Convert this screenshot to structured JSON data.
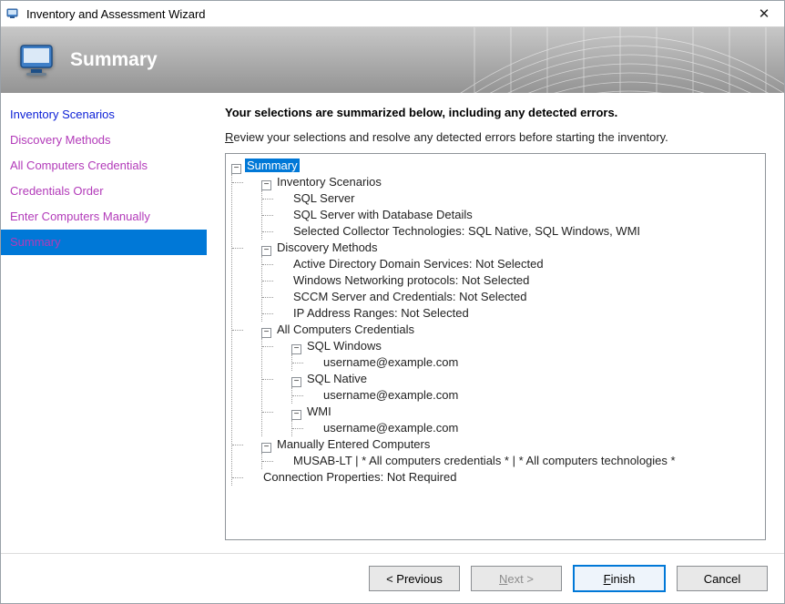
{
  "window": {
    "title": "Inventory and Assessment Wizard"
  },
  "banner": {
    "title": "Summary"
  },
  "sidebar": {
    "items": [
      {
        "label": "Inventory Scenarios",
        "color": "blue",
        "selected": false
      },
      {
        "label": "Discovery Methods",
        "color": "magenta",
        "selected": false
      },
      {
        "label": "All Computers Credentials",
        "color": "magenta",
        "selected": false
      },
      {
        "label": "Credentials Order",
        "color": "magenta",
        "selected": false
      },
      {
        "label": "Enter Computers Manually",
        "color": "magenta",
        "selected": false
      },
      {
        "label": "Summary",
        "color": "magenta",
        "selected": true
      }
    ]
  },
  "main": {
    "heading": "Your selections are summarized below, including any detected errors.",
    "subtext_prefix_accel": "R",
    "subtext_rest": "eview your selections and resolve any detected errors before starting the inventory."
  },
  "tree": {
    "root_label": "Summary",
    "inventory_scenarios": {
      "label": "Inventory Scenarios",
      "items": [
        "SQL Server",
        "SQL Server with Database Details",
        "Selected Collector Technologies: SQL Native, SQL Windows, WMI"
      ]
    },
    "discovery_methods": {
      "label": "Discovery Methods",
      "items": [
        "Active Directory Domain Services: Not Selected",
        "Windows Networking protocols: Not Selected",
        "SCCM Server and Credentials: Not Selected",
        "IP Address Ranges: Not Selected"
      ]
    },
    "all_creds": {
      "label": "All Computers Credentials",
      "groups": [
        {
          "label": "SQL Windows",
          "user": "username@example.com"
        },
        {
          "label": "SQL Native",
          "user": "username@example.com"
        },
        {
          "label": "WMI",
          "user": "username@example.com"
        }
      ]
    },
    "manual": {
      "label": "Manually Entered Computers",
      "items": [
        "MUSAB-LT | * All computers credentials * | * All computers technologies *"
      ]
    },
    "conn_props": "Connection Properties: Not Required"
  },
  "footer": {
    "previous": "< Previous",
    "next_accel": "N",
    "next_rest": "ext >",
    "finish_accel": "F",
    "finish_rest": "inish",
    "cancel": "Cancel"
  }
}
